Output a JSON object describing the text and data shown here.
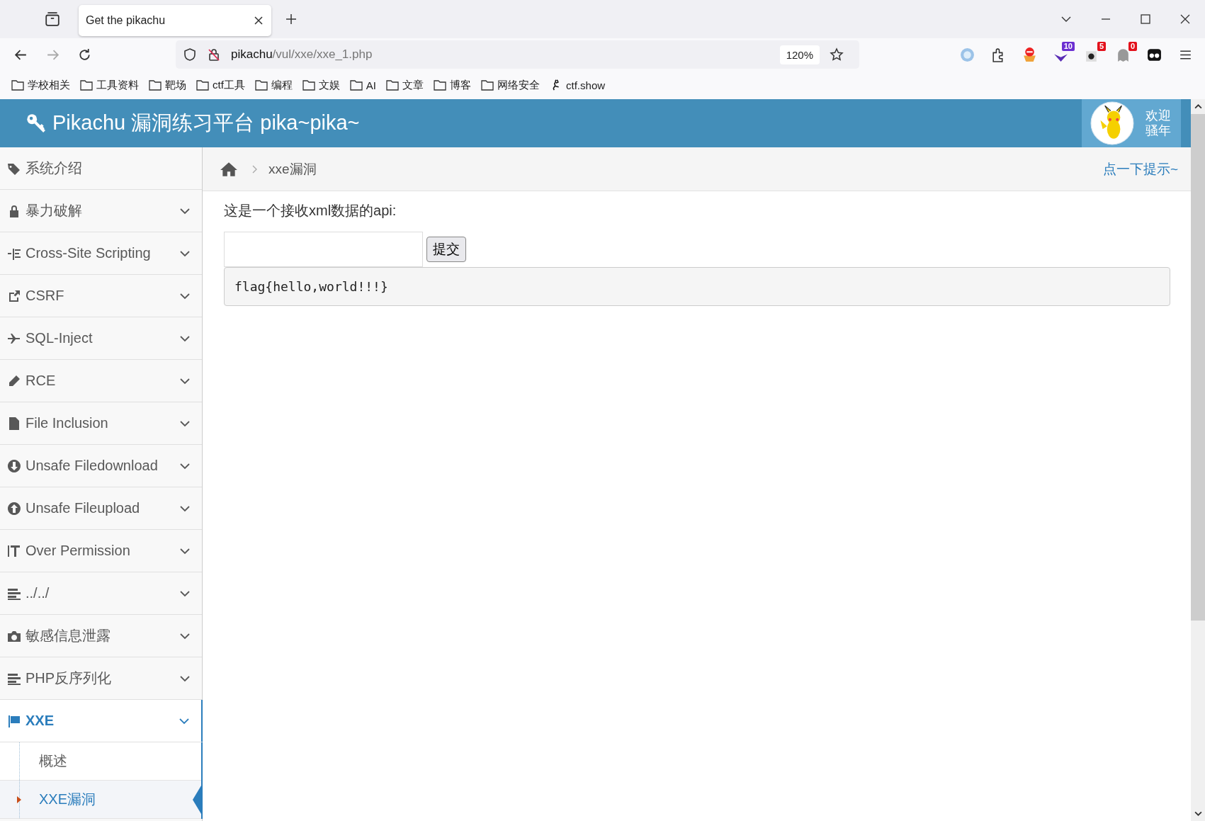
{
  "browser": {
    "tabs": [
      {
        "title": "Get the pikachu",
        "selected": true
      }
    ],
    "address": {
      "host": "pikachu",
      "path": "/vul/xxe/xxe_1.php"
    },
    "zoom": "120%",
    "extension_badges": [
      {
        "text": "10",
        "color": "#6b2fd1"
      },
      {
        "text": "5",
        "color": "#e3111b"
      },
      {
        "text": "0",
        "color": "#e3111b"
      }
    ],
    "bookmarks": [
      {
        "label": "学校相关",
        "kind": "folder"
      },
      {
        "label": "工具资料",
        "kind": "folder"
      },
      {
        "label": "靶场",
        "kind": "folder"
      },
      {
        "label": "ctf工具",
        "kind": "folder"
      },
      {
        "label": "编程",
        "kind": "folder"
      },
      {
        "label": "文娱",
        "kind": "folder"
      },
      {
        "label": "AI",
        "kind": "folder"
      },
      {
        "label": "文章",
        "kind": "folder"
      },
      {
        "label": "博客",
        "kind": "folder"
      },
      {
        "label": "网络安全",
        "kind": "folder"
      },
      {
        "label": "ctf.show",
        "kind": "site"
      }
    ]
  },
  "header": {
    "title": "Pikachu 漏洞练习平台 pika~pika~",
    "welcome": [
      "欢迎",
      "骚年"
    ]
  },
  "sidebar": {
    "items": [
      {
        "label": "系统介绍",
        "kind": "link",
        "selected": false
      },
      {
        "label": "暴力破解",
        "kind": "menu",
        "selected": false
      },
      {
        "label": "Cross-Site Scripting",
        "kind": "menu",
        "selected": false
      },
      {
        "label": "CSRF",
        "kind": "menu",
        "selected": false
      },
      {
        "label": "SQL-Inject",
        "kind": "menu",
        "selected": false
      },
      {
        "label": "RCE",
        "kind": "menu",
        "selected": false
      },
      {
        "label": "File Inclusion",
        "kind": "menu",
        "selected": false
      },
      {
        "label": "Unsafe Filedownload",
        "kind": "menu",
        "selected": false
      },
      {
        "label": "Unsafe Fileupload",
        "kind": "menu",
        "selected": false
      },
      {
        "label": "Over Permission",
        "kind": "menu",
        "selected": false
      },
      {
        "label": "../../",
        "kind": "menu",
        "selected": false
      },
      {
        "label": "敏感信息泄露",
        "kind": "menu",
        "selected": false
      },
      {
        "label": "PHP反序列化",
        "kind": "menu",
        "selected": false
      },
      {
        "label": "XXE",
        "kind": "menu",
        "selected": true,
        "children": [
          {
            "label": "概述",
            "selected": false
          },
          {
            "label": "XXE漏洞",
            "selected": true
          }
        ]
      }
    ]
  },
  "breadcrumb": {
    "current": "xxe漏洞",
    "hint_link": "点一下提示~"
  },
  "content": {
    "prompt": "这是一个接收xml数据的api:",
    "submit": "提交",
    "result": "flag{hello,world!!!}"
  }
}
